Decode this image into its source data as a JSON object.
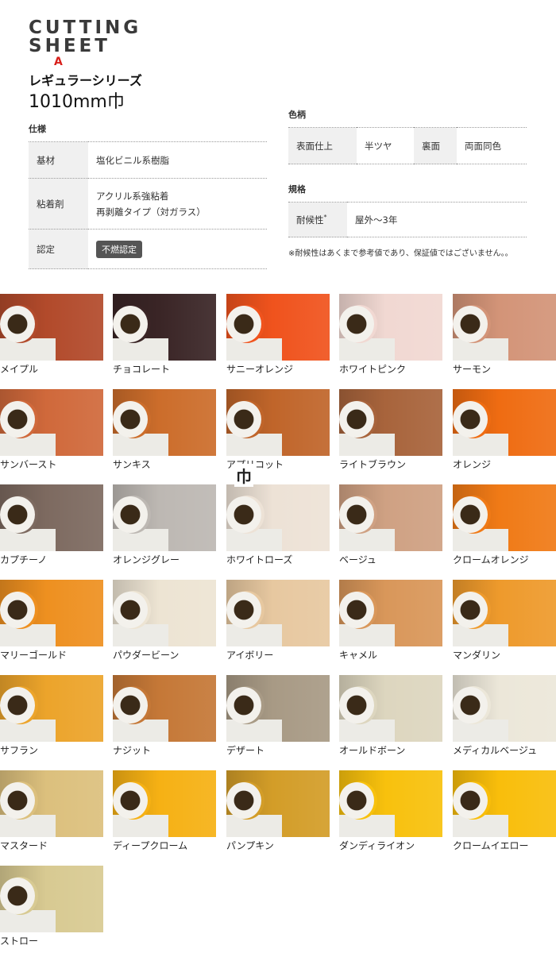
{
  "header": {
    "logo_line1": "CUTTING",
    "logo_line2": "SHEET",
    "logo_mark": "A",
    "series": "レギュラーシリーズ",
    "width": "1010mm巾"
  },
  "spec": {
    "title": "仕様",
    "rows": [
      {
        "label": "基材",
        "value": "塩化ビニル系樹脂"
      },
      {
        "label": "粘着剤",
        "value1": "アクリル系強粘着",
        "value2": "再剥離タイプ（対ガラス）"
      },
      {
        "label": "認定",
        "badge": "不燃認定"
      }
    ]
  },
  "pattern": {
    "title": "色柄",
    "surface_label": "表面仕上",
    "surface_value": "半ツヤ",
    "back_label": "裏面",
    "back_value": "両面同色"
  },
  "standard": {
    "title": "規格",
    "durability_label": "耐候性",
    "durability_mark": "*",
    "durability_value": "屋外～3年",
    "note": "※耐候性はあくまで参考値であり、保証値ではございません。。"
  },
  "stray_char": "巾",
  "swatches": [
    {
      "name": "メイプル",
      "color": "#b24a2b"
    },
    {
      "name": "チョコレート",
      "color": "#3a2526"
    },
    {
      "name": "サニーオレンジ",
      "color": "#f0531d"
    },
    {
      "name": "ホワイトピンク",
      "color": "#f1d8d2"
    },
    {
      "name": "サーモン",
      "color": "#d39478"
    },
    {
      "name": "サンバースト",
      "color": "#d0693b"
    },
    {
      "name": "サンキス",
      "color": "#cc6d2b"
    },
    {
      "name": "アプリコット",
      "color": "#c0652a"
    },
    {
      "name": "ライトブラウン",
      "color": "#a8643c"
    },
    {
      "name": "オレンジ",
      "color": "#ef6c12"
    },
    {
      "name": "カプチーノ",
      "color": "#7d6a60"
    },
    {
      "name": "オレンジグレー",
      "color": "#bdb8b3"
    },
    {
      "name": "ホワイトローズ",
      "color": "#ede2d6"
    },
    {
      "name": "ベージュ",
      "color": "#cfa183"
    },
    {
      "name": "クロームオレンジ",
      "color": "#f07a16"
    },
    {
      "name": "マリーゴールド",
      "color": "#ee9020"
    },
    {
      "name": "パウダービーン",
      "color": "#ede4d3"
    },
    {
      "name": "アイボリー",
      "color": "#e7c8a0"
    },
    {
      "name": "キャメル",
      "color": "#d9975a"
    },
    {
      "name": "マンダリン",
      "color": "#ee9a2c"
    },
    {
      "name": "サフラン",
      "color": "#eca42b"
    },
    {
      "name": "ナジット",
      "color": "#c57837"
    },
    {
      "name": "デザート",
      "color": "#a89a85"
    },
    {
      "name": "オールドボーン",
      "color": "#ddd6bf"
    },
    {
      "name": "メディカルベージュ",
      "color": "#ece7d9"
    },
    {
      "name": "マスタード",
      "color": "#dcc07d"
    },
    {
      "name": "ディープクローム",
      "color": "#f6b114"
    },
    {
      "name": "パンプキン",
      "color": "#d39d28"
    },
    {
      "name": "ダンディライオン",
      "color": "#f8c10d"
    },
    {
      "name": "クロームイエロー",
      "color": "#f9be0b"
    },
    {
      "name": "ストロー",
      "color": "#d8ca92"
    }
  ]
}
